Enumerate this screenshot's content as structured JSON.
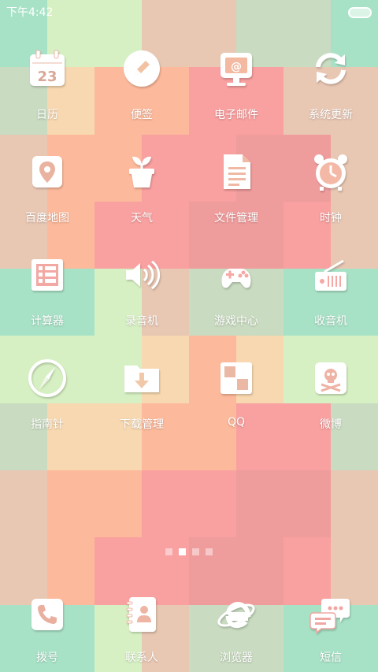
{
  "status": {
    "time": "下午4:42"
  },
  "apps": [
    {
      "label": "日历",
      "icon": "calendar-icon",
      "calendar_day": "23"
    },
    {
      "label": "便签",
      "icon": "note-pen-icon"
    },
    {
      "label": "电子邮件",
      "icon": "email-monitor-icon",
      "at": "@"
    },
    {
      "label": "系统更新",
      "icon": "sync-arrows-icon"
    },
    {
      "label": "百度地图",
      "icon": "map-pin-icon"
    },
    {
      "label": "天气",
      "icon": "sprout-pot-icon"
    },
    {
      "label": "文件管理",
      "icon": "document-icon"
    },
    {
      "label": "时钟",
      "icon": "alarm-clock-icon"
    },
    {
      "label": "计算器",
      "icon": "calculator-list-icon"
    },
    {
      "label": "录音机",
      "icon": "speaker-icon"
    },
    {
      "label": "游戏中心",
      "icon": "gamepad-icon"
    },
    {
      "label": "收音机",
      "icon": "radio-icon"
    },
    {
      "label": "指南针",
      "icon": "compass-icon"
    },
    {
      "label": "下载管理",
      "icon": "download-folder-icon"
    },
    {
      "label": "QQ",
      "icon": "qq-squares-icon"
    },
    {
      "label": "微博",
      "icon": "skull-crossbones-icon"
    }
  ],
  "dock": [
    {
      "label": "拨号",
      "icon": "phone-icon"
    },
    {
      "label": "联系人",
      "icon": "contacts-book-icon"
    },
    {
      "label": "浏览器",
      "icon": "browser-e-icon"
    },
    {
      "label": "短信",
      "icon": "chat-bubbles-icon"
    }
  ],
  "pager": {
    "pages": 4,
    "active_index": 1
  },
  "colors": {
    "wallpaper_palette": [
      "#a8e2c6",
      "#d7f0c3",
      "#f7d8b0",
      "#fcb99b",
      "#f9a0a0",
      "#ef9c9c",
      "#e8c7b3",
      "#c9dbc0"
    ],
    "icon_color": "#ffffff"
  }
}
